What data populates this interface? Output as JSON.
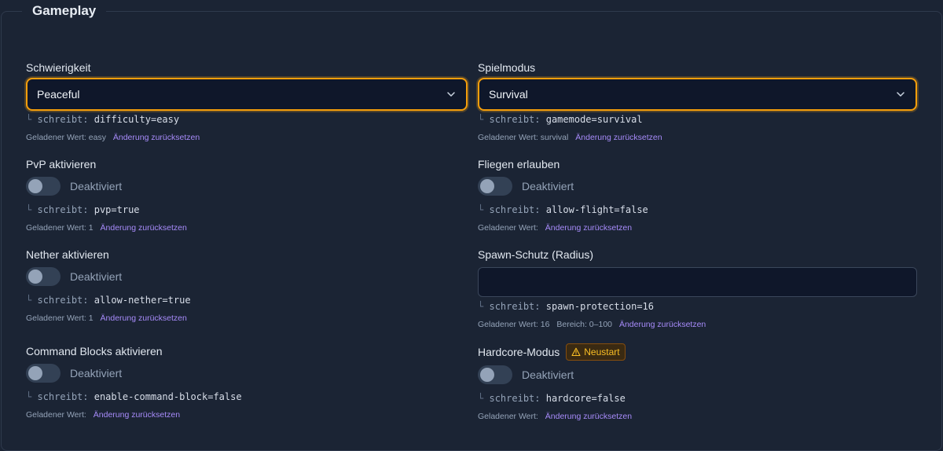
{
  "section": {
    "title": "Gameplay"
  },
  "left": {
    "difficulty": {
      "label": "Schwierigkeit",
      "selected": "Peaceful",
      "writes_word": "schreibt:",
      "writes_key": "difficulty=easy",
      "loaded_text": "Geladener Wert: easy",
      "reset": "Änderung zurücksetzen"
    },
    "pvp": {
      "label": "PvP aktivieren",
      "state": "Deaktiviert",
      "writes_word": "schreibt:",
      "writes_key": "pvp=true",
      "loaded_text": "Geladener Wert: 1",
      "reset": "Änderung zurücksetzen"
    },
    "nether": {
      "label": "Nether aktivieren",
      "state": "Deaktiviert",
      "writes_word": "schreibt:",
      "writes_key": "allow-nether=true",
      "loaded_text": "Geladener Wert: 1",
      "reset": "Änderung zurücksetzen"
    },
    "command_blocks": {
      "label": "Command Blocks aktivieren",
      "state": "Deaktiviert",
      "writes_word": "schreibt:",
      "writes_key": "enable-command-block=false",
      "loaded_text": "Geladener Wert:",
      "reset": "Änderung zurücksetzen"
    }
  },
  "right": {
    "gamemode": {
      "label": "Spielmodus",
      "selected": "Survival",
      "writes_word": "schreibt:",
      "writes_key": "gamemode=survival",
      "loaded_text": "Geladener Wert: survival",
      "reset": "Änderung zurücksetzen"
    },
    "flight": {
      "label": "Fliegen erlauben",
      "state": "Deaktiviert",
      "writes_word": "schreibt:",
      "writes_key": "allow-flight=false",
      "loaded_text": "Geladener Wert:",
      "reset": "Änderung zurücksetzen"
    },
    "spawn_protection": {
      "label": "Spawn-Schutz (Radius)",
      "value": "",
      "writes_word": "schreibt:",
      "writes_key": "spawn-protection=16",
      "loaded_text": "Geladener Wert: 16",
      "range": "Bereich: 0–100",
      "reset": "Änderung zurücksetzen"
    },
    "hardcore": {
      "label": "Hardcore-Modus",
      "badge": "Neustart",
      "state": "Deaktiviert",
      "writes_word": "schreibt:",
      "writes_key": "hardcore=false",
      "loaded_text": "Geladener Wert:",
      "reset": "Änderung zurücksetzen"
    }
  },
  "icons": {
    "tree": "└",
    "chevron": "chevron-down-icon",
    "warning": "warning-icon"
  },
  "colors": {
    "background": "#1b2434",
    "focus_ring": "#f59e0b",
    "link": "#a78bfa",
    "badge_text": "#fbbf24"
  }
}
